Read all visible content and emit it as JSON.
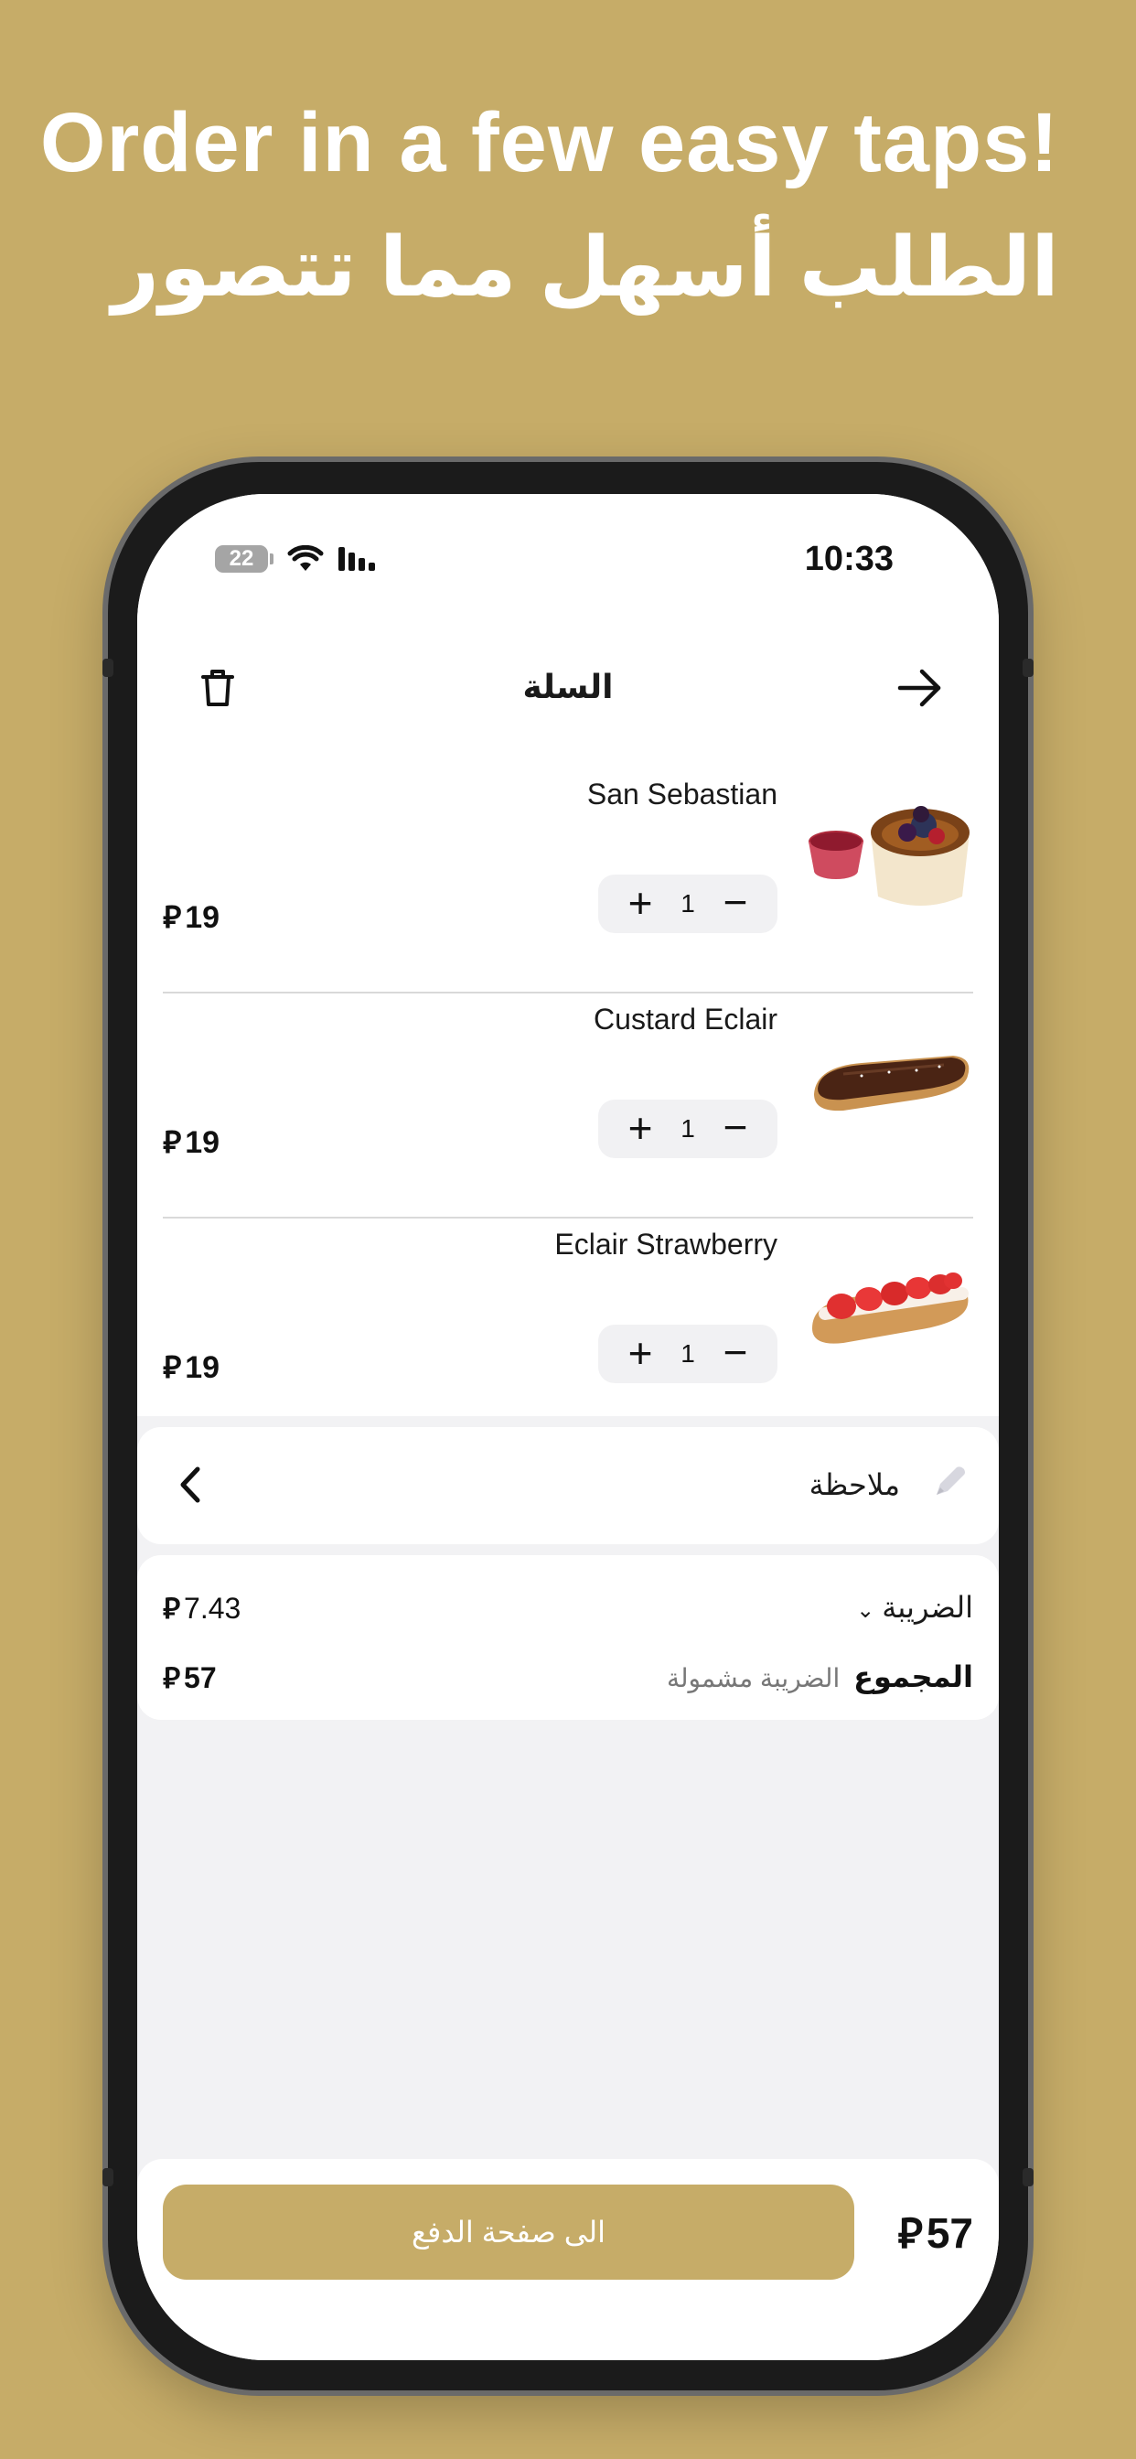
{
  "headline": {
    "english": "Order in a few easy taps!",
    "arabic": "الطلب أسهل مما تتصور"
  },
  "status_bar": {
    "battery": "22",
    "time": "10:33"
  },
  "header": {
    "title": "السلة",
    "delete_icon": "trash-icon",
    "back_icon": "arrow-right-icon"
  },
  "currency_symbol": "⃁",
  "items": [
    {
      "name": "San Sebastian",
      "quantity": "1",
      "price": "19",
      "image": "cheesecake-with-berries"
    },
    {
      "name": "Custard Eclair",
      "quantity": "1",
      "price": "19",
      "image": "chocolate-eclair"
    },
    {
      "name": "Eclair Strawberry",
      "quantity": "1",
      "price": "19",
      "image": "strawberry-eclair"
    }
  ],
  "note": {
    "label": "ملاحظة"
  },
  "totals": {
    "tax_label": "الضريبة",
    "tax_value": "7.43",
    "total_label": "المجموع",
    "total_hint": "الضريبة مشمولة",
    "total_value": "57"
  },
  "bottom_bar": {
    "checkout_label": "الى صفحة الدفع",
    "total": "57"
  },
  "colors": {
    "background": "#c6ac68",
    "accent": "#c6ac68",
    "screen_bg": "#f2f2f4"
  }
}
